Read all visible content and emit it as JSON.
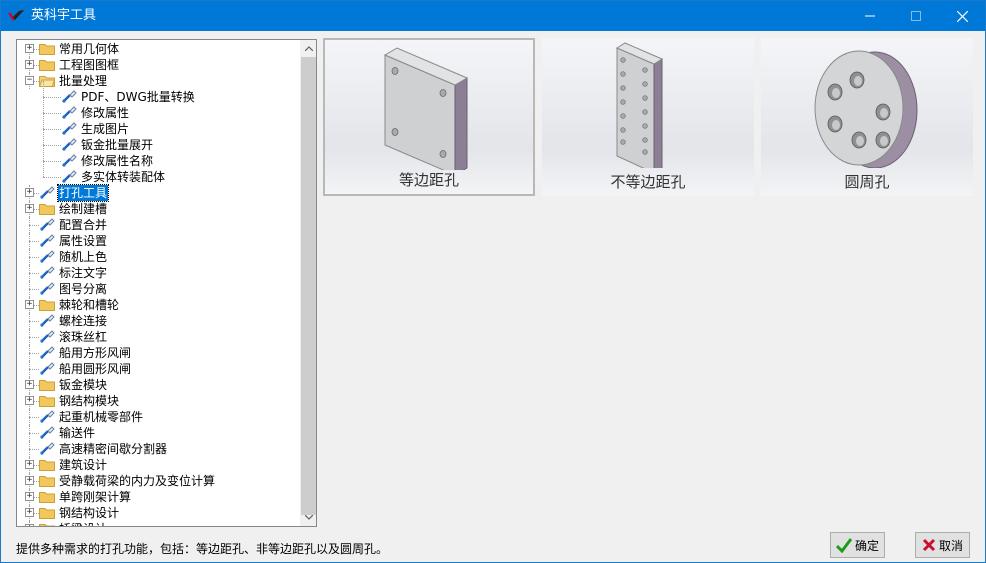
{
  "window": {
    "title": "英科宇工具",
    "min_icon": "minimize-icon",
    "max_icon": "maximize-icon",
    "close_icon": "close-icon"
  },
  "tree": {
    "items": [
      {
        "label": "常用几何体",
        "level": 0,
        "kind": "folder",
        "expander": "+"
      },
      {
        "label": "工程图图框",
        "level": 0,
        "kind": "folder",
        "expander": "+"
      },
      {
        "label": "批量处理",
        "level": 0,
        "kind": "folder-open",
        "expander": "−"
      },
      {
        "label": "PDF、DWG批量转换",
        "level": 1,
        "kind": "tool"
      },
      {
        "label": "修改属性",
        "level": 1,
        "kind": "tool"
      },
      {
        "label": "生成图片",
        "level": 1,
        "kind": "tool"
      },
      {
        "label": "钣金批量展开",
        "level": 1,
        "kind": "tool"
      },
      {
        "label": "修改属性名称",
        "level": 1,
        "kind": "tool"
      },
      {
        "label": "多实体转装配体",
        "level": 1,
        "kind": "tool"
      },
      {
        "label": "打孔工具",
        "level": 0,
        "kind": "tool",
        "expander": "+",
        "selected": true
      },
      {
        "label": "绘制建槽",
        "level": 0,
        "kind": "folder",
        "expander": "+"
      },
      {
        "label": "配置合并",
        "level": 0,
        "kind": "tool"
      },
      {
        "label": "属性设置",
        "level": 0,
        "kind": "tool"
      },
      {
        "label": "随机上色",
        "level": 0,
        "kind": "tool"
      },
      {
        "label": "标注文字",
        "level": 0,
        "kind": "tool"
      },
      {
        "label": "图号分离",
        "level": 0,
        "kind": "tool"
      },
      {
        "label": "棘轮和槽轮",
        "level": 0,
        "kind": "folder",
        "expander": "+"
      },
      {
        "label": "螺栓连接",
        "level": 0,
        "kind": "tool"
      },
      {
        "label": "滚珠丝杠",
        "level": 0,
        "kind": "tool"
      },
      {
        "label": "船用方形风闸",
        "level": 0,
        "kind": "tool"
      },
      {
        "label": "船用圆形风闸",
        "level": 0,
        "kind": "tool"
      },
      {
        "label": "钣金模块",
        "level": 0,
        "kind": "folder",
        "expander": "+"
      },
      {
        "label": "钢结构模块",
        "level": 0,
        "kind": "folder",
        "expander": "+"
      },
      {
        "label": "起重机械零部件",
        "level": 0,
        "kind": "tool"
      },
      {
        "label": "输送件",
        "level": 0,
        "kind": "tool"
      },
      {
        "label": "高速精密间歇分割器",
        "level": 0,
        "kind": "tool"
      },
      {
        "label": "建筑设计",
        "level": 0,
        "kind": "folder",
        "expander": "+"
      },
      {
        "label": "受静载荷梁的内力及变位计算",
        "level": 0,
        "kind": "folder",
        "expander": "+"
      },
      {
        "label": "单跨刚架计算",
        "level": 0,
        "kind": "folder",
        "expander": "+"
      },
      {
        "label": "钢结构设计",
        "level": 0,
        "kind": "folder",
        "expander": "+"
      },
      {
        "label": "桥梁设计",
        "level": 0,
        "kind": "folder",
        "expander": "+"
      }
    ]
  },
  "cards": [
    {
      "label": "等边距孔",
      "selected": true
    },
    {
      "label": "不等边距孔",
      "selected": false
    },
    {
      "label": "圆周孔",
      "selected": false
    }
  ],
  "status_text": "提供多种需求的打孔功能，包括：等边距孔、非等边距孔以及圆周孔。",
  "buttons": {
    "ok_label": "确定",
    "cancel_label": "取消"
  }
}
